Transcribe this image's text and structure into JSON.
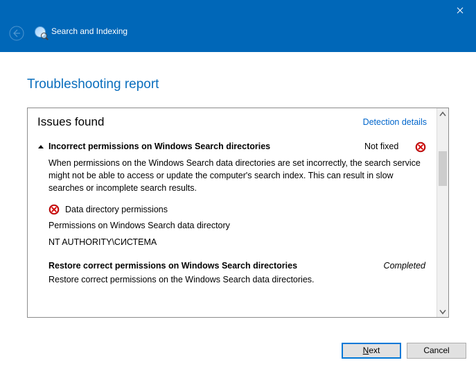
{
  "header": {
    "title": "Search and Indexing"
  },
  "page": {
    "title": "Troubleshooting report"
  },
  "report": {
    "section_title": "Issues found",
    "details_link": "Detection details",
    "issue": {
      "title": "Incorrect permissions on Windows Search directories",
      "status": "Not fixed",
      "description": "When permissions on the Windows Search data directories are set incorrectly, the search service might not be able to access or update the computer's search index. This can result in slow searches or incomplete search results.",
      "sub": {
        "title": "Data directory permissions",
        "line1": "Permissions on Windows Search data directory",
        "line2": "NT AUTHORITY\\СИСТЕМА"
      },
      "action": {
        "title": "Restore correct permissions on Windows Search directories",
        "status": "Completed",
        "description": "Restore correct permissions on the Windows Search data directories."
      }
    }
  },
  "footer": {
    "next": "ext",
    "next_prefix": "N",
    "cancel": "Cancel"
  }
}
